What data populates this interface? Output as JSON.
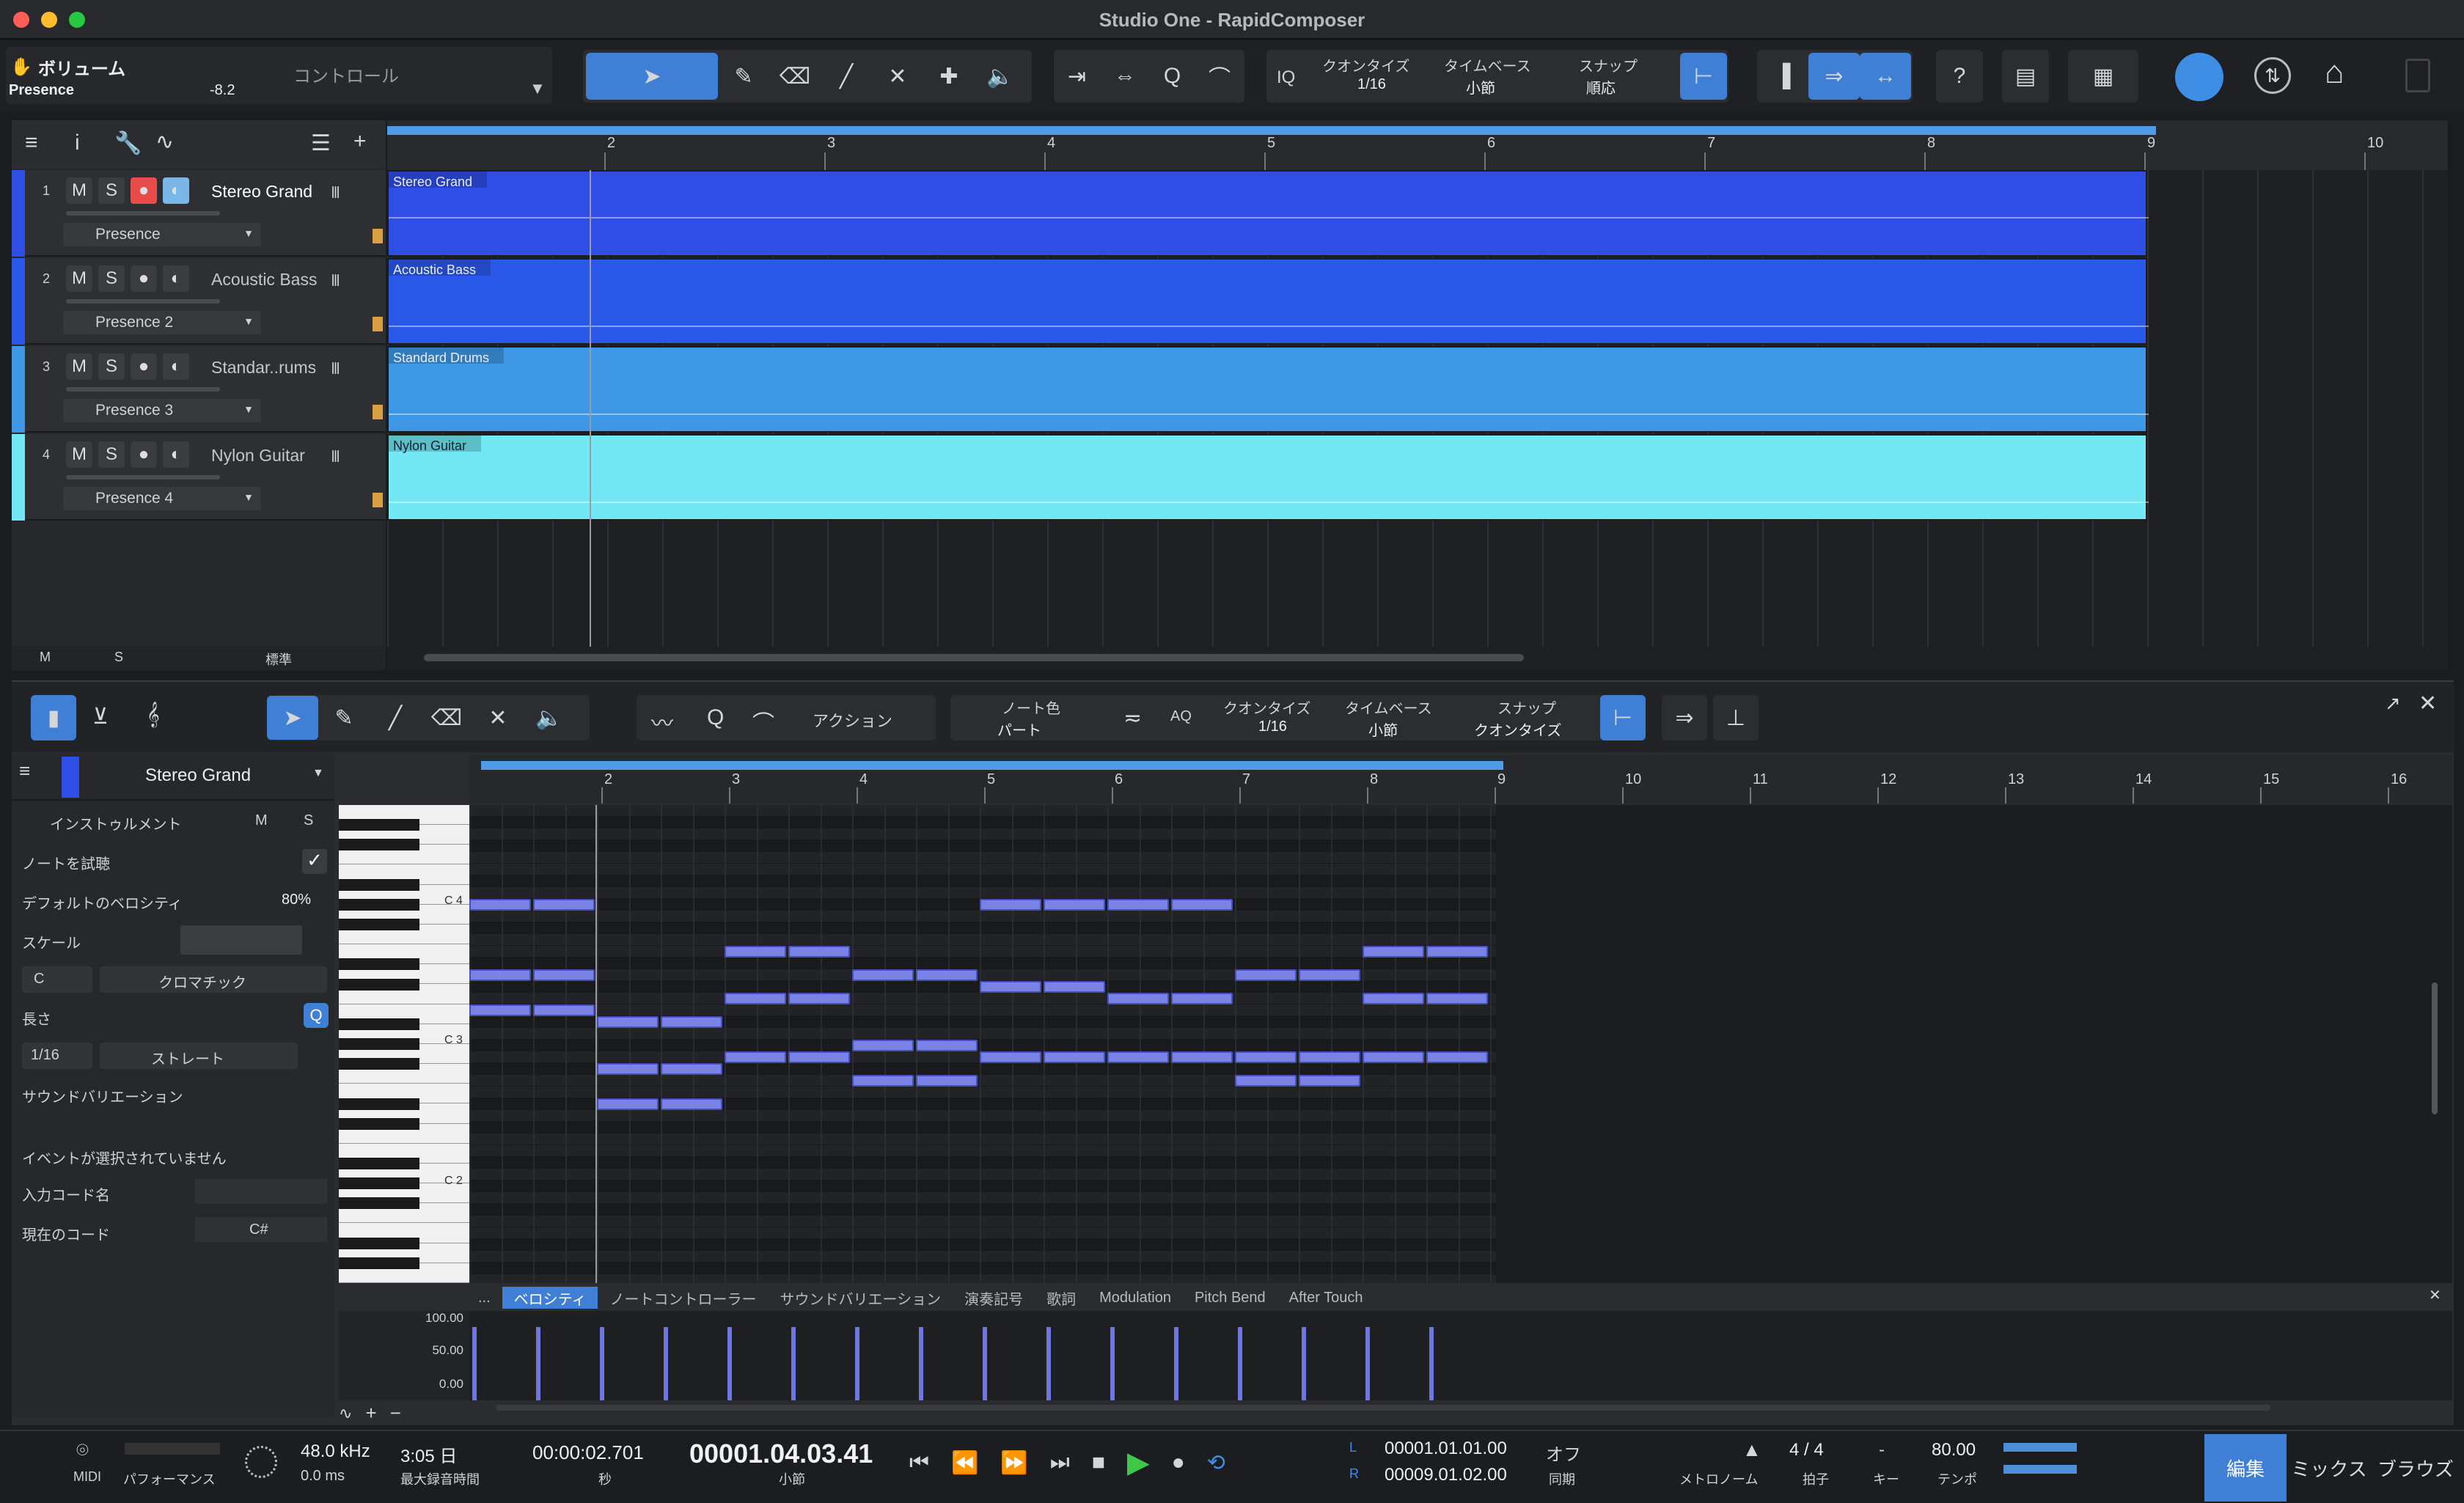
{
  "window": {
    "title": "Studio One - RapidComposer"
  },
  "top_left": {
    "param_name": "ボリューム",
    "param_preset": "Presence",
    "param_value": "-8.2",
    "control_label": "コントロール"
  },
  "toolbar": {
    "quantize_label": "クオンタイズ",
    "quantize_value": "1/16",
    "timebase_label": "タイムベース",
    "timebase_value": "小節",
    "snap_label": "スナップ",
    "snap_value": "順応",
    "iq_label": "IQ"
  },
  "arrange_ruler": [
    "2",
    "3",
    "4",
    "5",
    "6",
    "7",
    "8",
    "9",
    "10"
  ],
  "tracks": [
    {
      "num": "1",
      "name": "Stereo Grand",
      "preset": "Presence",
      "color": "#2f4ee6",
      "event": "Stereo Grand",
      "rec": true
    },
    {
      "num": "2",
      "name": "Acoustic Bass",
      "preset": "Presence 2",
      "color": "#2a59ea",
      "event": "Acoustic Bass",
      "rec": false
    },
    {
      "num": "3",
      "name": "Standar..rums",
      "preset": "Presence 3",
      "color": "#3f98e6",
      "event": "Standard Drums",
      "rec": false
    },
    {
      "num": "4",
      "name": "Nylon Guitar",
      "preset": "Presence 4",
      "color": "#72e8f5",
      "event": "Nylon Guitar",
      "rec": false
    }
  ],
  "track_footer": {
    "m": "M",
    "s": "S",
    "view": "標準"
  },
  "editor_toolbar": {
    "action_label": "アクション",
    "note_color_label": "ノート色",
    "note_color_value": "パート",
    "aq_label": "AQ",
    "quantize_label": "クオンタイズ",
    "quantize_value": "1/16",
    "timebase_label": "タイムベース",
    "timebase_value": "小節",
    "snap_label": "スナップ",
    "snap_value": "クオンタイズ"
  },
  "editor_ruler": [
    "2",
    "3",
    "4",
    "5",
    "6",
    "7",
    "8",
    "9",
    "10",
    "11",
    "12",
    "13",
    "14",
    "15",
    "16"
  ],
  "inspector": {
    "track_name": "Stereo Grand",
    "instrument_label": "インストゥルメント",
    "m": "M",
    "s": "S",
    "audition_label": "ノートを試聴",
    "default_velocity_label": "デフォルトのベロシティ",
    "default_velocity_value": "80%",
    "scale_label": "スケール",
    "scale_root": "C",
    "scale_type": "クロマチック",
    "length_label": "長さ",
    "length_value": "1/16",
    "length_mode": "ストレート",
    "sound_variation_label": "サウンドバリエーション",
    "no_event_label": "イベントが選択されていません",
    "chord_input_label": "入力コード名",
    "current_chord_label": "現在のコード",
    "current_chord_value": "C#"
  },
  "piano_labels": {
    "c4": "C 4",
    "c3": "C 3",
    "c2": "C 2"
  },
  "lane_tabs": [
    "...",
    "ベロシティ",
    "ノートコントローラー",
    "サウンドバリエーション",
    "演奏記号",
    "歌詞",
    "Modulation",
    "Pitch Bend",
    "After Touch"
  ],
  "velocity_axis": [
    "100.00",
    "50.00",
    "0.00"
  ],
  "transport": {
    "midi_label": "MIDI",
    "performance_label": "パフォーマンス",
    "sample_rate": "48.0 kHz",
    "latency": "0.0 ms",
    "record_time": "3:05 日",
    "record_time_label": "最大録音時間",
    "seconds": "00:00:02.701",
    "seconds_label": "秒",
    "bars": "00001.04.03.41",
    "bars_label": "小節",
    "loop_l": "00001.01.01.00",
    "loop_r": "00009.01.02.00",
    "l": "L",
    "r": "R",
    "sync_value": "オフ",
    "sync_label": "同期",
    "metronome_label": "メトロノーム",
    "signature": "4 / 4",
    "signature_label": "拍子",
    "key": "-",
    "key_label": "キー",
    "tempo": "80.00",
    "tempo_label": "テンポ",
    "edit_tab": "編集",
    "mix_tab": "ミックス",
    "browse_tab": "ブラウズ"
  },
  "colors": {
    "accent": "#3f7fd6",
    "note": "#7b82e6",
    "rec": "#e94a4a"
  }
}
